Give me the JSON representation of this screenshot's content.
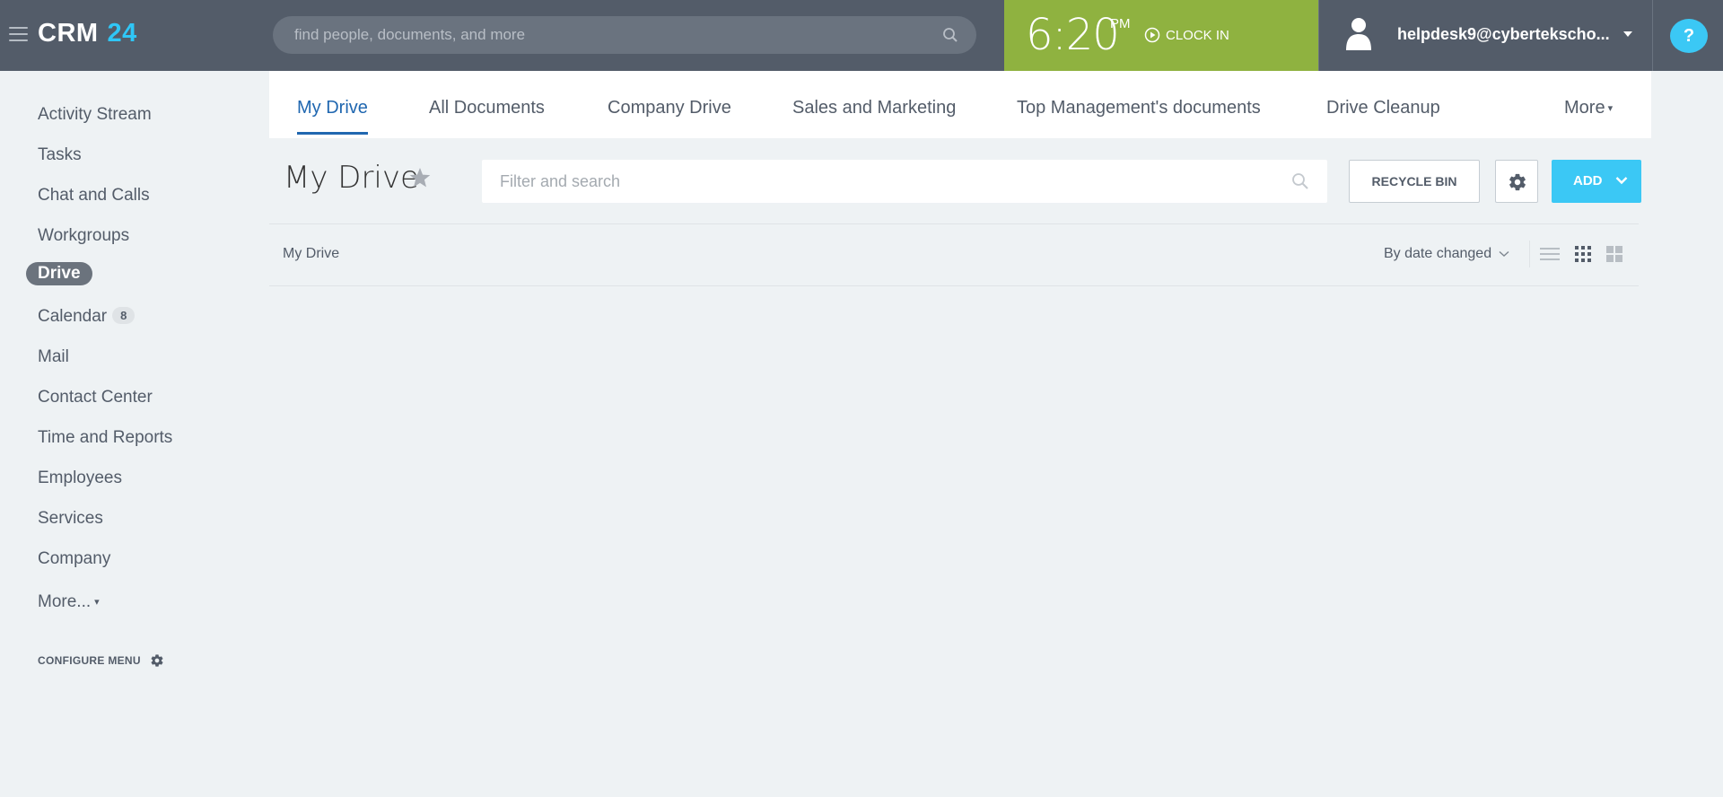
{
  "header": {
    "logo_main": "CRM",
    "logo_num": "24",
    "search_placeholder": "find people, documents, and more",
    "clock_time": "6:20",
    "clock_ampm": "PM",
    "clock_in_label": "CLOCK IN",
    "user_name": "helpdesk9@cybertekscho...",
    "help_label": "?"
  },
  "sidebar": {
    "items": [
      {
        "label": "Activity Stream"
      },
      {
        "label": "Tasks"
      },
      {
        "label": "Chat and Calls"
      },
      {
        "label": "Workgroups"
      },
      {
        "label": "Drive"
      },
      {
        "label": "Calendar",
        "badge": "8"
      },
      {
        "label": "Mail"
      },
      {
        "label": "Contact Center"
      },
      {
        "label": "Time and Reports"
      },
      {
        "label": "Employees"
      },
      {
        "label": "Services"
      },
      {
        "label": "Company"
      },
      {
        "label": "More..."
      }
    ],
    "active": "Drive",
    "configure_label": "CONFIGURE MENU"
  },
  "tabs": [
    {
      "label": "My Drive"
    },
    {
      "label": "All Documents"
    },
    {
      "label": "Company Drive"
    },
    {
      "label": "Sales and Marketing"
    },
    {
      "label": "Top Management's documents"
    },
    {
      "label": "Drive Cleanup"
    },
    {
      "label": "More"
    }
  ],
  "toolbar": {
    "title": "My Drive",
    "filter_placeholder": "Filter and search",
    "recycle_bin_label": "RECYCLE BIN",
    "add_label": "ADD"
  },
  "content": {
    "breadcrumb": "My Drive",
    "sort_label": "By date changed"
  },
  "colors": {
    "header_bg": "#535c69",
    "clock_bg": "#8fb240",
    "accent": "#3bc8f5",
    "active_tab": "#2067b0"
  },
  "icons": [
    "menu-icon",
    "search-icon",
    "play-circle-icon",
    "user-avatar-icon",
    "chevron-down-icon",
    "star-icon",
    "gear-icon",
    "list-view-icon",
    "grid-view-icon",
    "tile-view-icon"
  ]
}
